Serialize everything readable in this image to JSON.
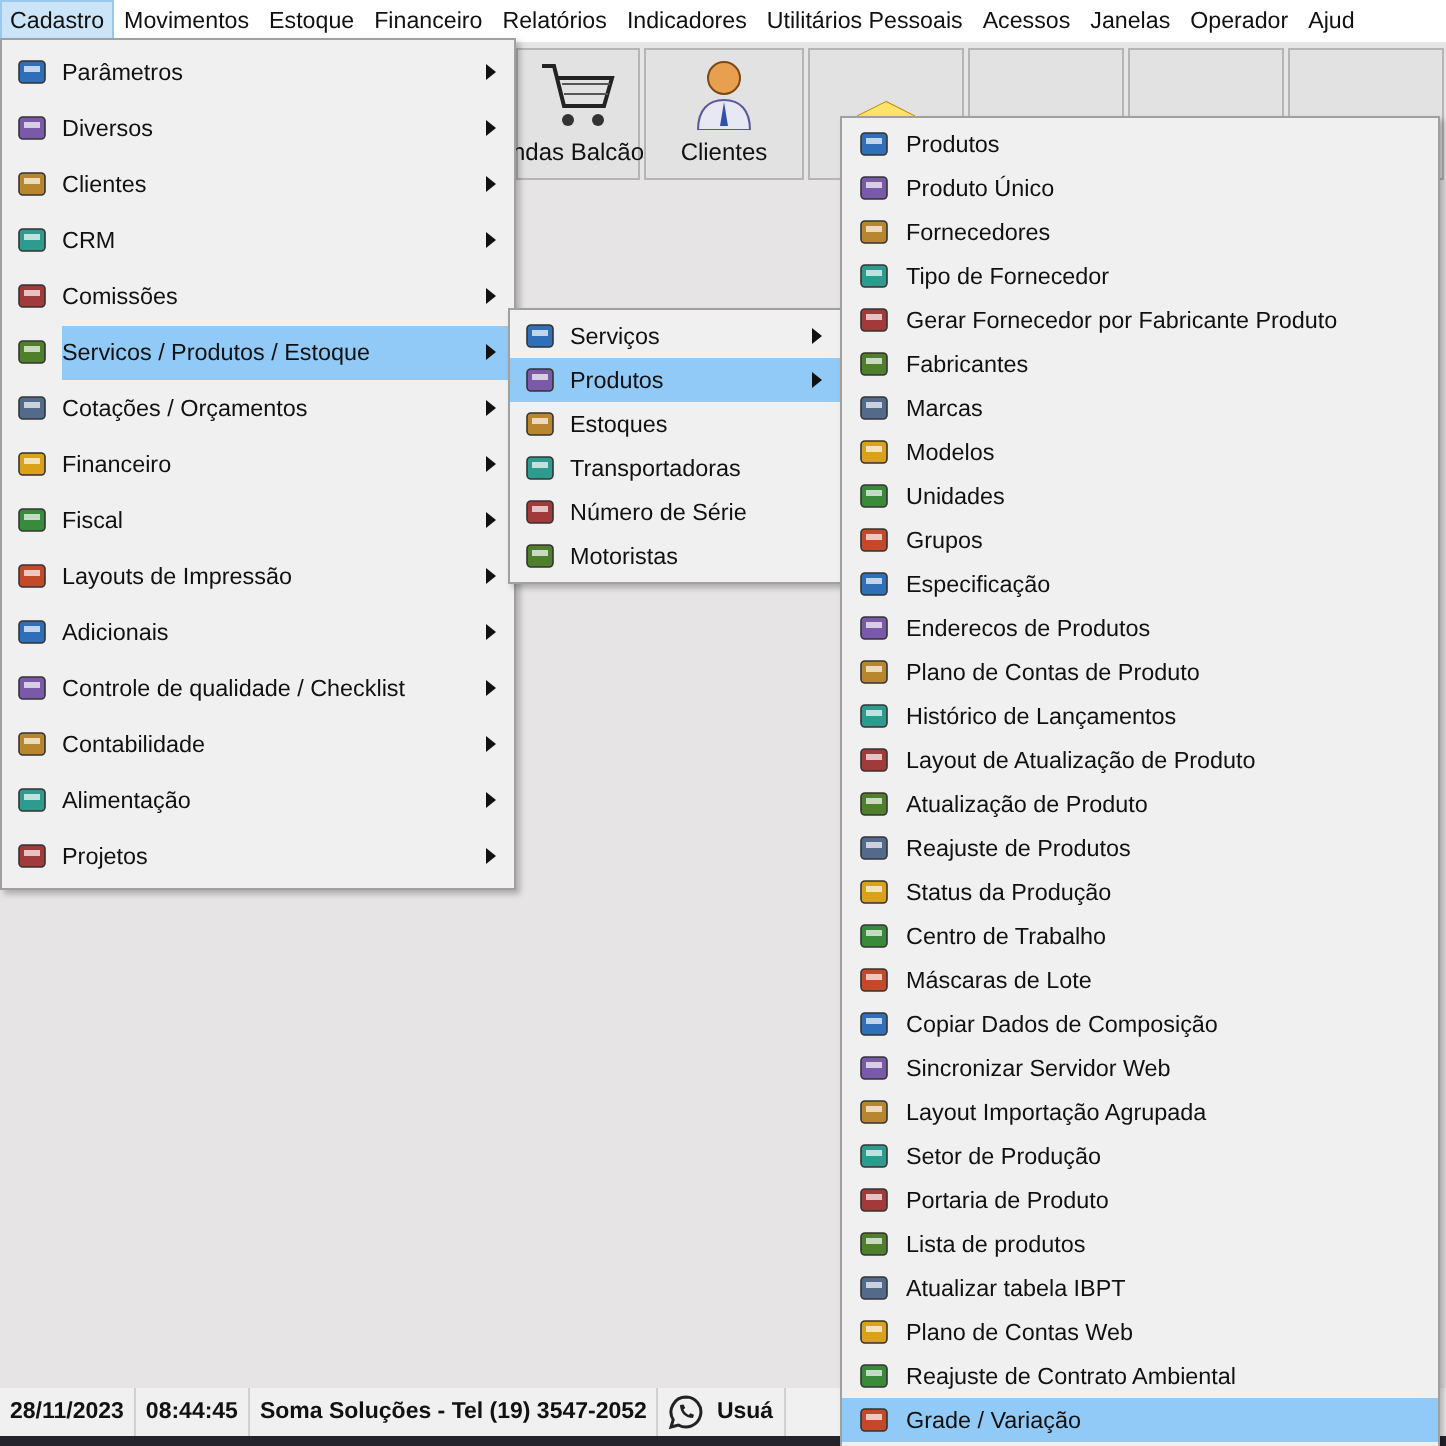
{
  "menu_bar": [
    {
      "label": "Cadastro",
      "selected": true
    },
    {
      "label": "Movimentos",
      "selected": false
    },
    {
      "label": "Estoque",
      "selected": false
    },
    {
      "label": "Financeiro",
      "selected": false
    },
    {
      "label": "Relatórios",
      "selected": false
    },
    {
      "label": "Indicadores",
      "selected": false
    },
    {
      "label": "Utilitários Pessoais",
      "selected": false
    },
    {
      "label": "Acessos",
      "selected": false
    },
    {
      "label": "Janelas",
      "selected": false
    },
    {
      "label": "Operador",
      "selected": false
    },
    {
      "label": "Ajud",
      "selected": false
    }
  ],
  "toolbar": [
    {
      "kind": "labeled",
      "label": "ndas Balcão"
    },
    {
      "kind": "labeled",
      "label": "Clientes"
    },
    {
      "kind": "icon"
    },
    {
      "kind": "icon"
    },
    {
      "kind": "icon"
    },
    {
      "kind": "icon"
    }
  ],
  "cadastro_menu": [
    {
      "label": "Parâmetros",
      "has_submenu": true,
      "selected": false
    },
    {
      "label": "Diversos",
      "has_submenu": true,
      "selected": false
    },
    {
      "label": "Clientes",
      "has_submenu": true,
      "selected": false
    },
    {
      "label": "CRM",
      "has_submenu": true,
      "selected": false
    },
    {
      "label": "Comissões",
      "has_submenu": true,
      "selected": false
    },
    {
      "label": "Servicos / Produtos / Estoque",
      "has_submenu": true,
      "selected": true
    },
    {
      "label": "Cotações / Orçamentos",
      "has_submenu": true,
      "selected": false
    },
    {
      "label": "Financeiro",
      "has_submenu": true,
      "selected": false
    },
    {
      "label": "Fiscal",
      "has_submenu": true,
      "selected": false
    },
    {
      "label": "Layouts de Impressão",
      "has_submenu": true,
      "selected": false
    },
    {
      "label": "Adicionais",
      "has_submenu": true,
      "selected": false
    },
    {
      "label": "Controle de qualidade / Checklist",
      "has_submenu": true,
      "selected": false
    },
    {
      "label": "Contabilidade",
      "has_submenu": true,
      "selected": false
    },
    {
      "label": "Alimentação",
      "has_submenu": true,
      "selected": false
    },
    {
      "label": "Projetos",
      "has_submenu": true,
      "selected": false
    }
  ],
  "servicos_menu": [
    {
      "label": "Serviços",
      "has_submenu": true,
      "selected": false
    },
    {
      "label": "Produtos",
      "has_submenu": true,
      "selected": true
    },
    {
      "label": "Estoques",
      "has_submenu": false,
      "selected": false
    },
    {
      "label": "Transportadoras",
      "has_submenu": false,
      "selected": false
    },
    {
      "label": "Número de Série",
      "has_submenu": false,
      "selected": false
    },
    {
      "label": "Motoristas",
      "has_submenu": false,
      "selected": false
    }
  ],
  "produtos_menu": [
    {
      "label": "Produtos",
      "selected": false
    },
    {
      "label": "Produto Único",
      "selected": false
    },
    {
      "label": "Fornecedores",
      "selected": false
    },
    {
      "label": "Tipo de Fornecedor",
      "selected": false
    },
    {
      "label": "Gerar Fornecedor por Fabricante Produto",
      "selected": false
    },
    {
      "label": "Fabricantes",
      "selected": false
    },
    {
      "label": "Marcas",
      "selected": false
    },
    {
      "label": "Modelos",
      "selected": false
    },
    {
      "label": "Unidades",
      "selected": false
    },
    {
      "label": "Grupos",
      "selected": false
    },
    {
      "label": "Especificação",
      "selected": false
    },
    {
      "label": "Enderecos de Produtos",
      "selected": false
    },
    {
      "label": "Plano de Contas de Produto",
      "selected": false
    },
    {
      "label": "Histórico de Lançamentos",
      "selected": false
    },
    {
      "label": "Layout de Atualização de Produto",
      "selected": false
    },
    {
      "label": "Atualização de Produto",
      "selected": false
    },
    {
      "label": "Reajuste de Produtos",
      "selected": false
    },
    {
      "label": "Status da Produção",
      "selected": false
    },
    {
      "label": "Centro de Trabalho",
      "selected": false
    },
    {
      "label": "Máscaras de Lote",
      "selected": false
    },
    {
      "label": "Copiar Dados de Composição",
      "selected": false
    },
    {
      "label": "Sincronizar Servidor Web",
      "selected": false
    },
    {
      "label": "Layout Importação Agrupada",
      "selected": false
    },
    {
      "label": "Setor de Produção",
      "selected": false
    },
    {
      "label": "Portaria de Produto",
      "selected": false
    },
    {
      "label": "Lista de produtos",
      "selected": false
    },
    {
      "label": "Atualizar tabela IBPT",
      "selected": false
    },
    {
      "label": "Plano de Contas Web",
      "selected": false
    },
    {
      "label": "Reajuste de Contrato Ambiental",
      "selected": false
    },
    {
      "label": "Grade / Variação",
      "selected": true
    }
  ],
  "status_bar": {
    "date": "28/11/2023",
    "time": "08:44:45",
    "company": "Soma Soluções - Tel (19) 3547-2052",
    "user": "Usuá"
  }
}
